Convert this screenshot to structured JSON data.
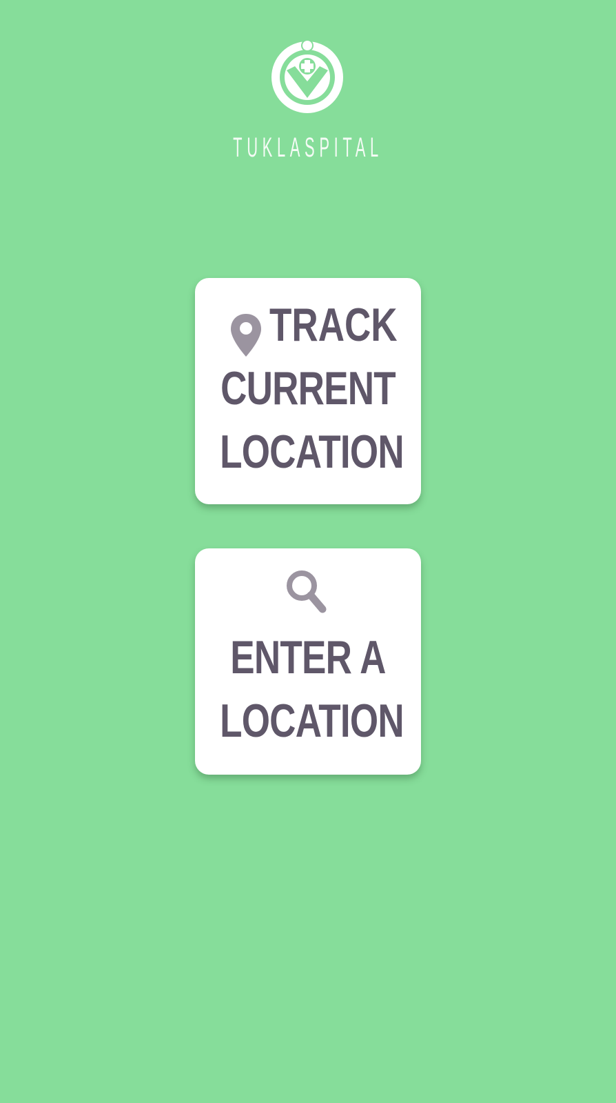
{
  "brand": {
    "name": "TUKLASPITAL",
    "logo_icon": "hospital-heart-hand-icon"
  },
  "colors": {
    "background": "#86dd9a",
    "card": "#ffffff",
    "text": "#5f5769",
    "icon": "#9b94a0"
  },
  "actions": {
    "track": {
      "icon": "map-pin-icon",
      "first": "TRACK",
      "line2": "CURRENT",
      "line3": "LOCATION"
    },
    "enter": {
      "icon": "search-icon",
      "line1": "ENTER A",
      "line2": "LOCATION"
    }
  }
}
